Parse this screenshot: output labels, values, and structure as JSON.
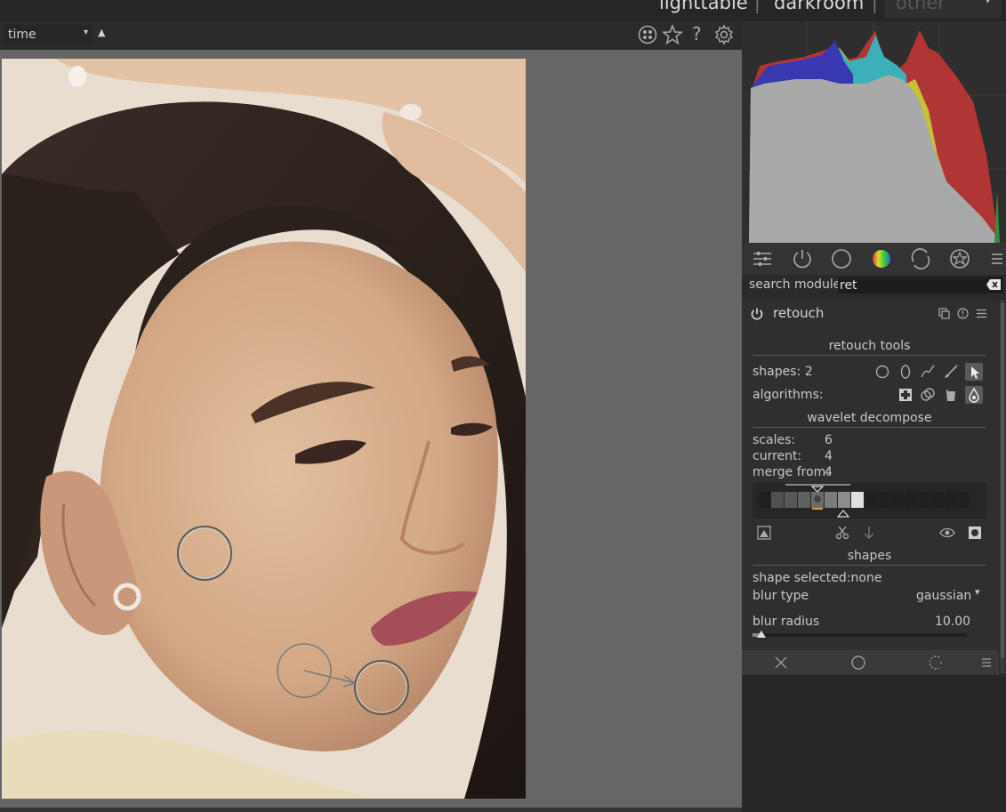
{
  "header": {
    "views": [
      {
        "label": "lighttable"
      },
      {
        "label": "darkroom"
      },
      {
        "label": "other"
      }
    ],
    "separator": "|"
  },
  "toolbar": {
    "sort_value": "time",
    "sort_order_glyph": "▲",
    "dropdown_glyph": "▾",
    "icons": [
      "grouping-icon",
      "star-icon",
      "help-icon",
      "gear-icon"
    ],
    "help_glyph": "?"
  },
  "modules": {
    "group_icons": [
      "quick-access-icon",
      "active-modules-icon",
      "base-group-icon",
      "color-group-icon",
      "correct-group-icon",
      "effects-group-icon",
      "presets-menu-icon"
    ],
    "search_label": "search module",
    "search_value": "ret"
  },
  "retouch": {
    "name": "retouch",
    "retouch_tools_title": "retouch tools",
    "shapes_label": "shapes: 2",
    "algorithms_label": "algorithms:",
    "shape_icons": [
      "circle-icon",
      "ellipse-icon",
      "path-icon",
      "brush-icon",
      "show-shapes-icon"
    ],
    "algorithm_icons": [
      "clone-icon",
      "heal-icon",
      "fill-icon",
      "blur-icon"
    ],
    "active_algorithm": "blur-icon",
    "wavelet_title": "wavelet decompose",
    "scales_label": "scales:",
    "scales_value": "6",
    "current_label": "current:",
    "current_value": "4",
    "merge_label": "merge from:",
    "merge_value": "4",
    "shapes_title": "shapes",
    "shape_selected": "shape selected:none",
    "blur_type_label": "blur type",
    "blur_type_value": "gaussian",
    "blur_radius_label": "blur radius",
    "blur_radius_value": "10.00",
    "dropdown_glyph": "▾"
  },
  "colors": {
    "accent": "#e0a030",
    "panel": "#2f2f2f",
    "center_bg": "#666666"
  }
}
